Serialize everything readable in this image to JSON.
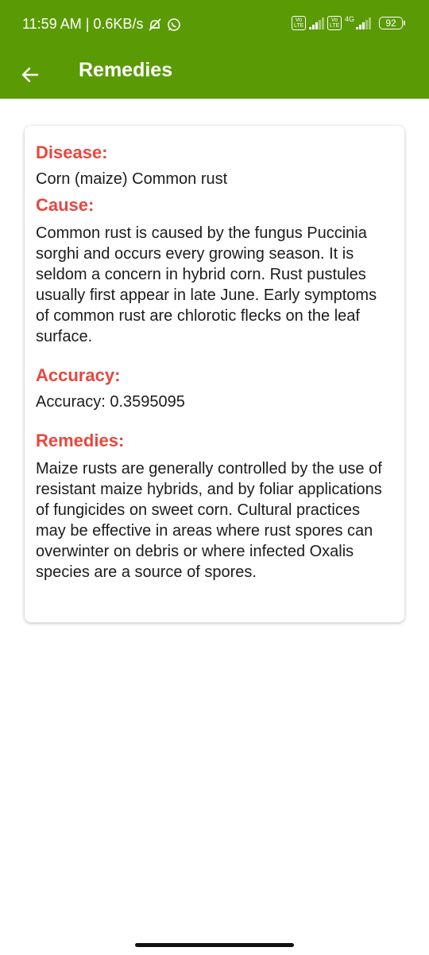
{
  "status_bar": {
    "time": "11:59 AM",
    "separator": " | ",
    "net_speed": "0.6KB/s",
    "volte1": "Vo LTE",
    "volte2": "Vo LTE",
    "network_type": "4G",
    "battery": "92",
    "icons": [
      "mute-bell-icon",
      "whatsapp-icon",
      "signal-icon",
      "battery-icon"
    ]
  },
  "app_bar": {
    "title": "Remedies",
    "back_icon": "arrow-back-icon",
    "color": "#5a9a05"
  },
  "card": {
    "disease_label": "Disease:",
    "disease_value": "Corn (maize) Common rust",
    "cause_label": "Cause:",
    "cause_value": "Common rust is caused by the fungus Puccinia sorghi and occurs every growing season. It is seldom a concern in hybrid corn. Rust pustules usually first appear in late June. Early symptoms of common rust are chlorotic flecks on the leaf surface.",
    "accuracy_label": "Accuracy:",
    "accuracy_value": "Accuracy: 0.3595095",
    "remedies_label": "Remedies:",
    "remedies_value": "Maize rusts are generally controlled by the use of resistant maize hybrids, and by foliar applications of fungicides on sweet corn. Cultural practices may be effective in areas where rust spores can overwinter on debris or where infected Oxalis species are a source of spores.",
    "heading_color": "#e8473e"
  }
}
